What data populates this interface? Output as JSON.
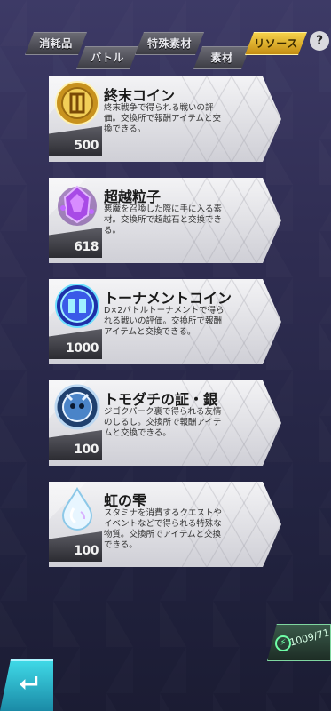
{
  "tabs": {
    "consumables": "消耗品",
    "special_materials": "特殊素材",
    "battle": "バトル",
    "materials": "素材",
    "resources": "リソース",
    "help": "?"
  },
  "items": [
    {
      "title": "終末コイン",
      "description": "終末戦争で得られる戦いの評価。交換所で報酬アイテムと交換できる。",
      "count": "500",
      "icon": "doom-coin-icon",
      "color": "#e2b33c"
    },
    {
      "title": "超越粒子",
      "description": "悪魔を召喚した際に手に入る素材。交換所で超越石と交換できる。",
      "count": "618",
      "icon": "transcendence-particle-icon",
      "color": "#8a3cc8"
    },
    {
      "title": "トーナメントコイン",
      "description": "D×2バトルトーナメントで得られる戦いの評価。交換所で報酬アイテムと交換できる。",
      "count": "1000",
      "icon": "tournament-coin-icon",
      "color": "#3a6ae8"
    },
    {
      "title": "トモダチの証・銀",
      "description": "ジゴクパーク裏で得られる友情のしるし。交換所で報酬アイテムと交換できる。",
      "count": "100",
      "icon": "friend-silver-badge-icon",
      "color": "#4a84c8"
    },
    {
      "title": "虹の雫",
      "description": "スタミナを消費するクエストやイベントなどで得られる特殊な物質。交換所でアイテムと交換できる。",
      "count": "100",
      "icon": "rainbow-drop-icon",
      "color": "#cfe6f4"
    }
  ],
  "stamina": "1009/71",
  "back_label": "⮠"
}
